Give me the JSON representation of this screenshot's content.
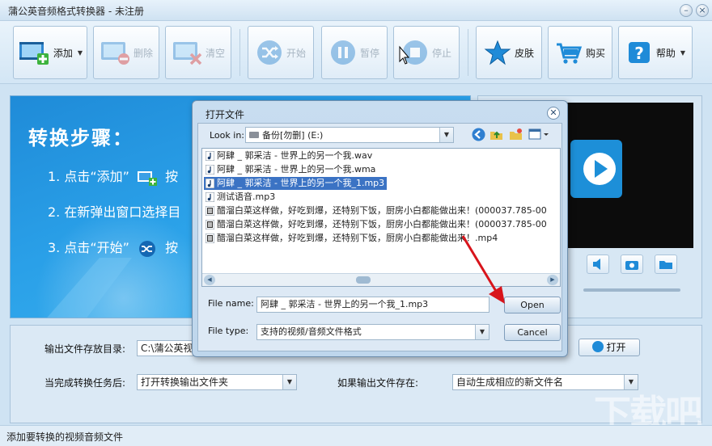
{
  "window": {
    "title": "蒲公英音频格式转换器 - 未注册",
    "minimize_glyph": "–",
    "close_glyph": "×"
  },
  "toolbar": {
    "add": "添加",
    "delete": "删除",
    "clear": "清空",
    "start": "开始",
    "pause": "暂停",
    "stop": "停止",
    "skin": "皮肤",
    "buy": "购买",
    "help": "帮助"
  },
  "steps": {
    "title": "转换步骤：",
    "step1_a": "1. 点击“添加”",
    "step1_b": "按",
    "step2": "2. 在新弹出窗口选择目",
    "step3_a": "3. 点击“开始”",
    "step3_b": "按"
  },
  "settings": {
    "output_dir_label": "输出文件存放目录:",
    "output_dir_value": "C:\\蒲公英视频",
    "open_button": "打开",
    "after_label": "当完成转换任务后:",
    "after_value": "打开转换输出文件夹",
    "exists_label": "如果输出文件存在:",
    "exists_value": "自动生成相应的新文件名"
  },
  "statusbar": {
    "text": "添加要转换的视频音频文件"
  },
  "watermark": "下载吧",
  "dialog": {
    "title": "打开文件",
    "look_in_label": "Look in:",
    "look_in_value": "备份[勿删] (E:)",
    "files": [
      {
        "name": "阿肆 _ 郭采洁 - 世界上的另一个我.wav",
        "selected": false,
        "icon": "music-note-icon"
      },
      {
        "name": "阿肆 _ 郭采洁 - 世界上的另一个我.wma",
        "selected": false,
        "icon": "music-note-icon"
      },
      {
        "name": "阿肆 _ 郭采洁 - 世界上的另一个我_1.mp3",
        "selected": true,
        "icon": "music-note-icon"
      },
      {
        "name": "测试语音.mp3",
        "selected": false,
        "icon": "music-note-icon"
      },
      {
        "name": "醋溜白菜这样做，好吃到爆，还特别下饭，厨房小白都能做出来！(000037.785-00",
        "selected": false,
        "icon": "video-file-icon"
      },
      {
        "name": "醋溜白菜这样做，好吃到爆，还特别下饭，厨房小白都能做出来！(000037.785-00",
        "selected": false,
        "icon": "video-file-icon"
      },
      {
        "name": "醋溜白菜这样做，好吃到爆，还特别下饭，厨房小白都能做出来！.mp4",
        "selected": false,
        "icon": "video-file-icon"
      }
    ],
    "file_name_label": "File name:",
    "file_name_value": "阿肆 _ 郭采洁 - 世界上的另一个我_1.mp3",
    "file_type_label": "File type:",
    "file_type_value": "支持的视频/音频文件格式",
    "open_button": "Open",
    "cancel_button": "Cancel"
  },
  "colors": {
    "accent_blue": "#1f8bd8",
    "selection": "#3b73c4",
    "annotation_arrow": "#d8141b"
  }
}
